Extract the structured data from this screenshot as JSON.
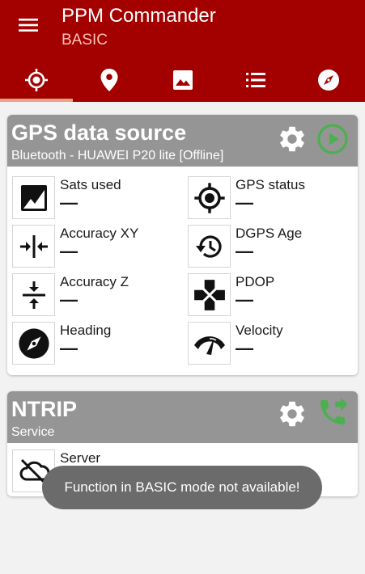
{
  "app": {
    "title": "PPM Commander",
    "mode": "BASIC",
    "colors": {
      "appbar": "#a30000",
      "accent_tab": "#e8a389",
      "card_header": "#959595",
      "green": "#4caf50"
    }
  },
  "tabs": [
    {
      "icon": "gps-fixed-icon",
      "active": true
    },
    {
      "icon": "location-pin-icon",
      "active": false
    },
    {
      "icon": "image-icon",
      "active": false
    },
    {
      "icon": "list-icon",
      "active": false
    },
    {
      "icon": "compass-icon",
      "active": false
    }
  ],
  "gps_card": {
    "title": "GPS data source",
    "subtitle": "Bluetooth - HUAWEI P20 lite [Offline]",
    "settings_icon": "gear-icon",
    "action_icon": "play-circle-icon",
    "tiles": [
      {
        "label": "Sats used",
        "value": "—",
        "icon": "satellite-image-icon"
      },
      {
        "label": "GPS status",
        "value": "—",
        "icon": "gps-fixed-icon"
      },
      {
        "label": "Accuracy XY",
        "value": "—",
        "icon": "horizontal-compress-icon"
      },
      {
        "label": "DGPS Age",
        "value": "—",
        "icon": "history-icon"
      },
      {
        "label": "Accuracy Z",
        "value": "—",
        "icon": "vertical-compress-icon"
      },
      {
        "label": "PDOP",
        "value": "—",
        "icon": "gamepad-icon"
      },
      {
        "label": "Heading",
        "value": "—",
        "icon": "compass-icon"
      },
      {
        "label": "Velocity",
        "value": "—",
        "icon": "speedometer-icon"
      }
    ]
  },
  "ntrip_card": {
    "title": "NTRIP",
    "subtitle": "Service",
    "settings_icon": "gear-icon",
    "action_icon": "phone-forwarded-icon",
    "tiles": [
      {
        "label": "Server",
        "icon": "cloud-off-icon"
      }
    ]
  },
  "toast": {
    "text": "Function in BASIC mode not available!"
  }
}
